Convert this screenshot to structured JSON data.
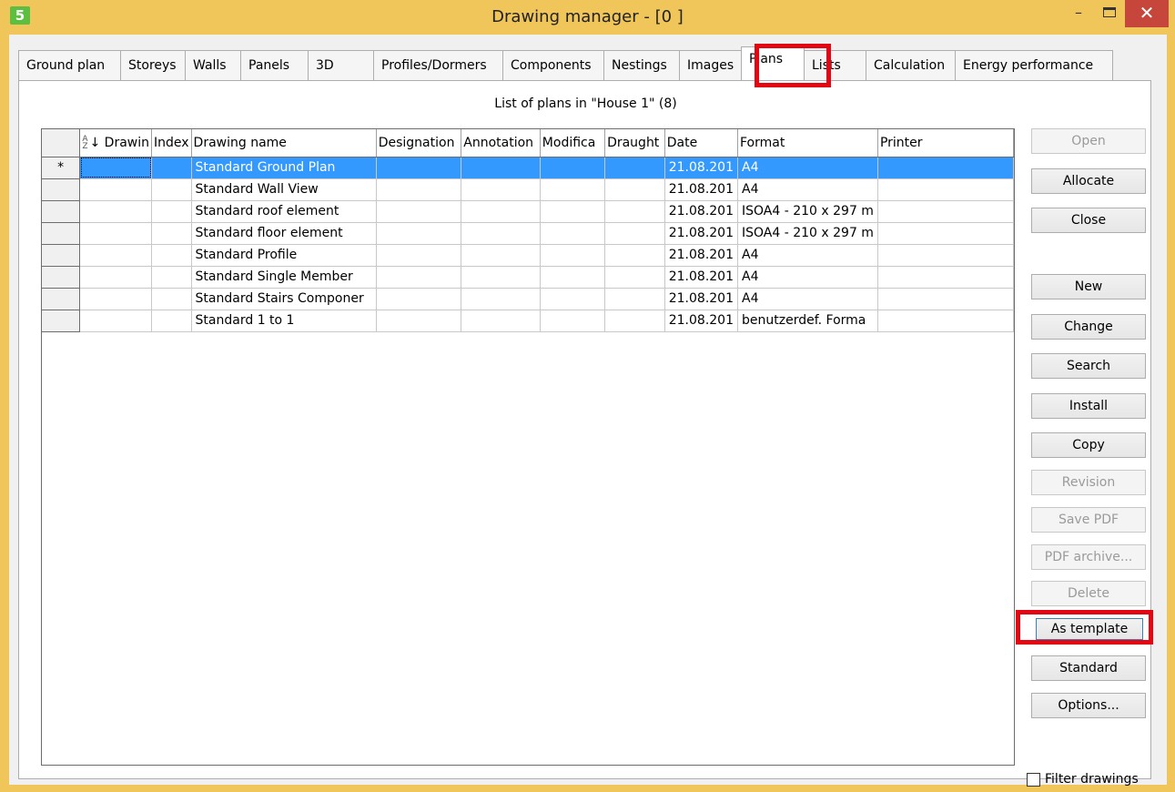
{
  "window": {
    "title": "Drawing manager - [0   ]",
    "app_icon": "5",
    "minimize": "–",
    "close": "✕"
  },
  "tabs": [
    "Ground plan",
    "Storeys",
    "Walls",
    "Panels",
    "3D",
    "Profiles/Dormers",
    "Components",
    "Nestings",
    "Images",
    "Plans",
    "Lists",
    "Calculation",
    "Energy performance"
  ],
  "active_tab": "Plans",
  "caption": "List of plans in \"House 1\" (8)",
  "table": {
    "columns": [
      "Drawin",
      "Index",
      "Drawing name",
      "Designation",
      "Annotation",
      "Modifica",
      "Draught",
      "Date",
      "Format",
      "Printer"
    ],
    "rows": [
      {
        "marker": "*",
        "name": "Standard Ground Plan",
        "date": "21.08.201",
        "format": "A4"
      },
      {
        "marker": "",
        "name": "Standard Wall View",
        "date": "21.08.201",
        "format": "A4"
      },
      {
        "marker": "",
        "name": "Standard roof element",
        "date": "21.08.201",
        "format": "ISOA4 - 210 x 297 m"
      },
      {
        "marker": "",
        "name": "Standard floor element",
        "date": "21.08.201",
        "format": "ISOA4 - 210 x 297 m"
      },
      {
        "marker": "",
        "name": "Standard Profile",
        "date": "21.08.201",
        "format": "A4"
      },
      {
        "marker": "",
        "name": "Standard Single Member",
        "date": "21.08.201",
        "format": "A4"
      },
      {
        "marker": "",
        "name": "Standard Stairs Componer",
        "date": "21.08.201",
        "format": "A4"
      },
      {
        "marker": "",
        "name": "Standard 1 to 1",
        "date": "21.08.201",
        "format": "benutzerdef. Forma"
      }
    ]
  },
  "buttons": {
    "open": "Open",
    "allocate": "Allocate",
    "close": "Close",
    "new": "New",
    "change": "Change",
    "search": "Search",
    "install": "Install",
    "copy": "Copy",
    "revision": "Revision",
    "save_pdf": "Save PDF",
    "pdf_archive": "PDF archive...",
    "delete": "Delete",
    "as_template": "As template",
    "standard": "Standard",
    "options": "Options..."
  },
  "filter_label": "Filter drawings",
  "colors": {
    "titlebar": "#f0c55a",
    "close_button": "#c7463c",
    "selection": "#3399ff",
    "highlight": "#e30613"
  }
}
